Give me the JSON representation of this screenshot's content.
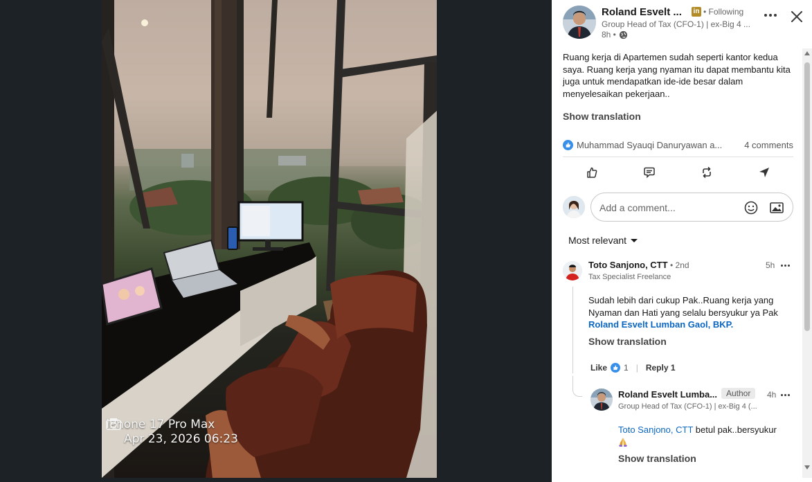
{
  "photo": {
    "caption_device": "iPhone 17 Pro Max",
    "caption_date": "Apr 23, 2026 06:23"
  },
  "post": {
    "author_name": "Roland Esvelt ...",
    "linkedin_badge": "in",
    "following": "• Following",
    "headline": "Group Head of Tax (CFO-1) | ex-Big 4 ...",
    "time": "8h •",
    "text": "Ruang kerja di Apartemen sudah seperti kantor kedua saya. Ruang kerja yang nyaman itu dapat membantu kita juga untuk mendapatkan ide-ide besar dalam menyelesaikan pekerjaan..",
    "show_translation": "Show translation",
    "reactors": "Muhammad Syauqi Danuryawan a...",
    "comments_count": "4 comments",
    "icons": {
      "like": "like-icon",
      "comment": "comment-icon",
      "repost": "repost-icon",
      "send": "send-icon"
    }
  },
  "comment_box": {
    "placeholder": "Add a comment...",
    "icons": {
      "emoji": "emoji-icon",
      "image": "image-icon"
    }
  },
  "sort": {
    "label": "Most relevant"
  },
  "comments": [
    {
      "name": "Toto Sanjono, CTT",
      "degree": "• 2nd",
      "headline": "Tax Specialist Freelance",
      "time": "5h",
      "text_prefix": "Sudah lebih dari cukup Pak..Ruang kerja yang Nyaman dan Hati yang selalu bersyukur ya Pak ",
      "mention": "Roland Esvelt Lumban Gaol, BKP.",
      "show_translation": "Show translation",
      "like_label": "Like",
      "like_count": "1",
      "reply_label": "Reply 1"
    },
    {
      "name": "Roland Esvelt Lumba...",
      "author_tag": "Author",
      "headline": "Group Head of Tax (CFO-1) | ex-Big 4 (...",
      "time": "4h",
      "mention": "Toto Sanjono, CTT",
      "text_suffix": " betul pak..bersyukur",
      "show_translation": "Show translation"
    }
  ],
  "colors": {
    "link": "#0a66c2",
    "badge": "#b38b26",
    "panel_bg": "#ffffff",
    "viewer_bg": "#1d2226"
  }
}
